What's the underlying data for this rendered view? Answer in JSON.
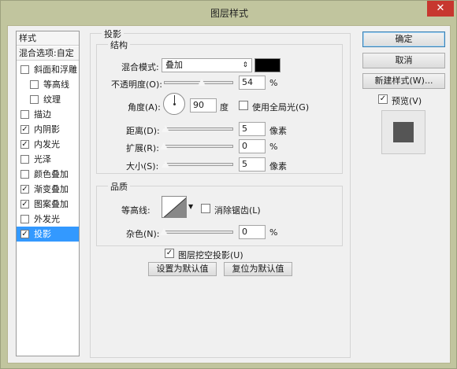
{
  "window": {
    "title": "图层样式",
    "close_glyph": "✕"
  },
  "styles_list": {
    "header": "样式",
    "blend_options": "混合选项:自定",
    "items": [
      {
        "label": "斜面和浮雕",
        "checked": false
      },
      {
        "label": "等高线",
        "checked": false
      },
      {
        "label": "纹理",
        "checked": false
      },
      {
        "label": "描边",
        "checked": false
      },
      {
        "label": "内阴影",
        "checked": true
      },
      {
        "label": "内发光",
        "checked": true
      },
      {
        "label": "光泽",
        "checked": false
      },
      {
        "label": "颜色叠加",
        "checked": false
      },
      {
        "label": "渐变叠加",
        "checked": true
      },
      {
        "label": "图案叠加",
        "checked": true
      },
      {
        "label": "外发光",
        "checked": false
      },
      {
        "label": "投影",
        "checked": true,
        "selected": true
      }
    ],
    "check_glyph": "✓"
  },
  "drop_shadow": {
    "group_title": "投影",
    "structure": {
      "title": "结构",
      "blend_mode_label": "混合模式:",
      "blend_mode_value": "叠加",
      "shadow_color": "#000000",
      "opacity_label": "不透明度(O):",
      "opacity_value": "54",
      "opacity_unit": "%",
      "opacity_level": 54,
      "angle_label": "角度(A):",
      "angle_value": "90",
      "angle_unit": "度",
      "global_light_label": "使用全局光(G)",
      "global_light_checked": false,
      "distance_label": "距离(D):",
      "distance_value": "5",
      "distance_unit": "像素",
      "spread_label": "扩展(R):",
      "spread_value": "0",
      "spread_unit": "%",
      "size_label": "大小(S):",
      "size_value": "5",
      "size_unit": "像素"
    },
    "quality": {
      "title": "品质",
      "contour_label": "等高线:",
      "anti_alias_label": "消除锯齿(L)",
      "anti_alias_checked": false,
      "noise_label": "杂色(N):",
      "noise_value": "0",
      "noise_unit": "%"
    },
    "knockout_label": "图层挖空投影(U)",
    "knockout_checked": true,
    "make_default": "设置为默认值",
    "reset_default": "复位为默认值"
  },
  "buttons": {
    "ok": "确定",
    "cancel": "取消",
    "new_style": "新建样式(W)...",
    "preview_label": "预览(V)",
    "preview_checked": true
  }
}
